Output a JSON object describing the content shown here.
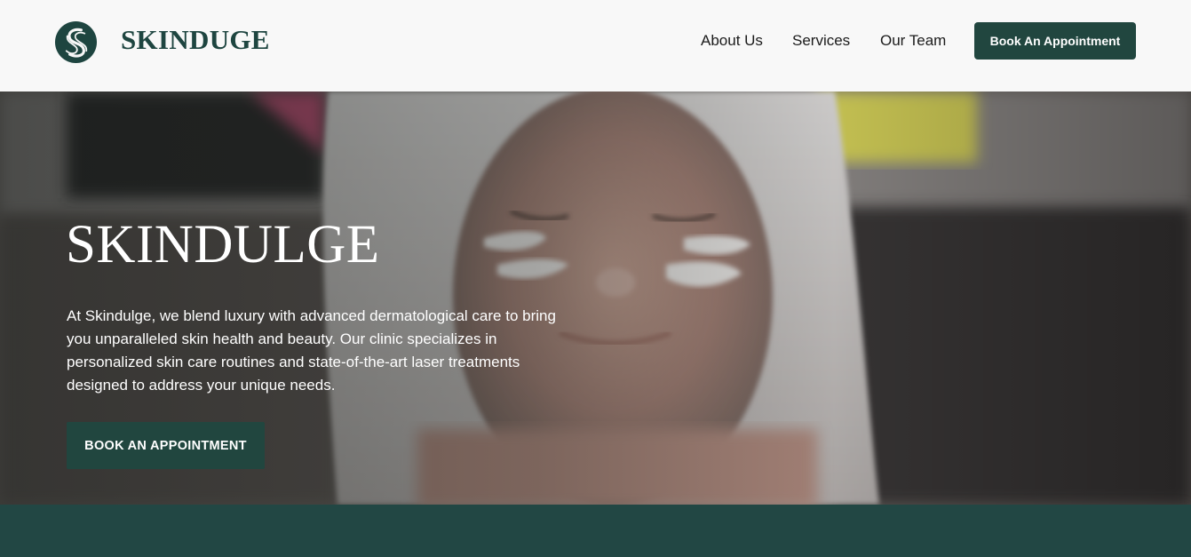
{
  "header": {
    "brand": "SKINDUGE",
    "logo_icon": "swirl-s-logo-icon",
    "nav": [
      {
        "label": "About Us"
      },
      {
        "label": "Services"
      },
      {
        "label": "Our Team"
      }
    ],
    "cta_label": "Book An Appointment"
  },
  "hero": {
    "title": "SKINDULGE",
    "description": "At Skindulge, we blend luxury with advanced dermatological care to bring you unparalleled skin health and beauty. Our clinic specializes in personalized skin care routines and state-of-the-art laser treatments designed to address your unique needs.",
    "cta_label": "BOOK AN APPOINTMENT"
  },
  "colors": {
    "brand_green": "#21463f",
    "header_bg": "#f8f8f8",
    "band_bg": "#224744"
  }
}
